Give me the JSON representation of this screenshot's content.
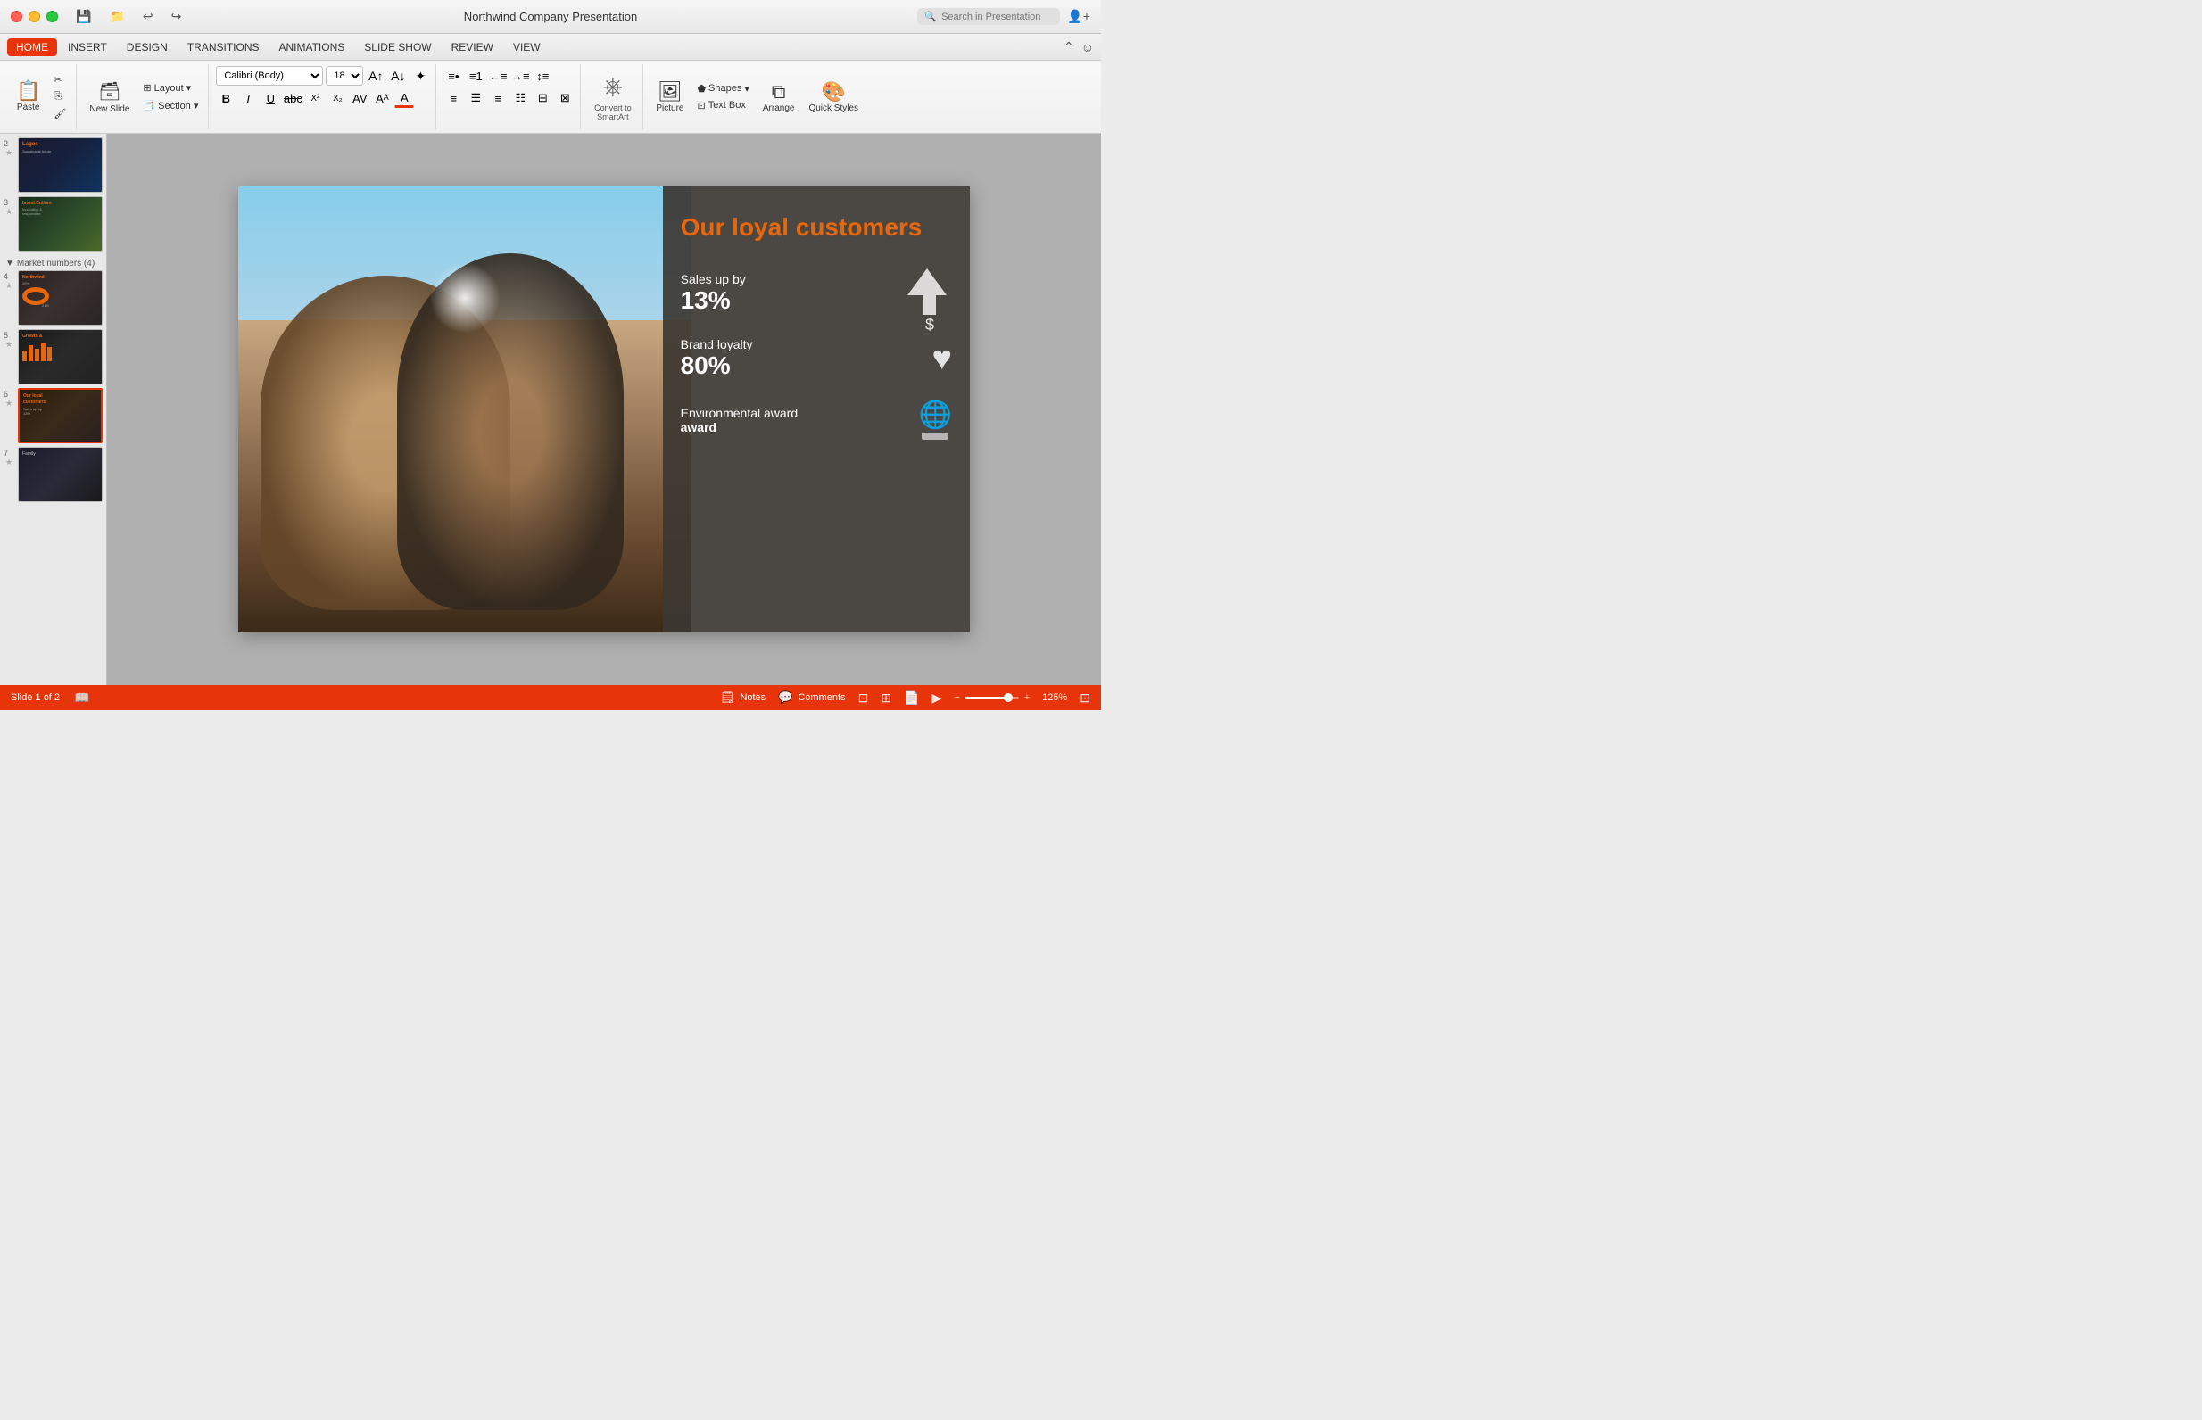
{
  "titlebar": {
    "title": "Northwind Company Presentation",
    "search_placeholder": "Search in Presentation",
    "icons": [
      "save",
      "folder",
      "undo",
      "redo"
    ]
  },
  "menubar": {
    "items": [
      {
        "label": "HOME",
        "active": true
      },
      {
        "label": "INSERT",
        "active": false
      },
      {
        "label": "DESIGN",
        "active": false
      },
      {
        "label": "TRANSITIONS",
        "active": false
      },
      {
        "label": "ANIMATIONS",
        "active": false
      },
      {
        "label": "SLIDE SHOW",
        "active": false
      },
      {
        "label": "REVIEW",
        "active": false
      },
      {
        "label": "VIEW",
        "active": false
      }
    ]
  },
  "ribbon": {
    "paste_label": "Paste",
    "new_slide_label": "New Slide",
    "layout_label": "Layout",
    "section_label": "Section",
    "font_name": "Calibri (Body)",
    "font_size": "18",
    "bold": "B",
    "italic": "I",
    "underline": "U",
    "picture_label": "Picture",
    "text_box_label": "Text Box",
    "arrange_label": "Arrange",
    "quick_styles_label": "Quick Styles",
    "shapes_label": "Shapes",
    "convert_label": "Convert to SmartArt"
  },
  "slides": [
    {
      "num": "2",
      "star": "★",
      "type": "dark"
    },
    {
      "num": "3",
      "star": "★",
      "type": "green"
    },
    {
      "section_label": "▼ Market numbers (4)"
    },
    {
      "num": "4",
      "star": "★",
      "type": "chart"
    },
    {
      "num": "5",
      "star": "★",
      "type": "bars"
    },
    {
      "num": "6",
      "star": "★",
      "type": "active"
    },
    {
      "num": "7",
      "star": "★",
      "type": "family"
    }
  ],
  "slide_content": {
    "title": "Our loyal customers",
    "stat1_label": "Sales up by",
    "stat1_value": "13%",
    "stat2_label": "Brand loyalty",
    "stat2_value": "80%",
    "stat3_label": "Environmental award",
    "stat3_value": ""
  },
  "statusbar": {
    "slide_info": "Slide 1 of 2",
    "notes_label": "Notes",
    "comments_label": "Comments",
    "zoom_pct": "125%"
  }
}
